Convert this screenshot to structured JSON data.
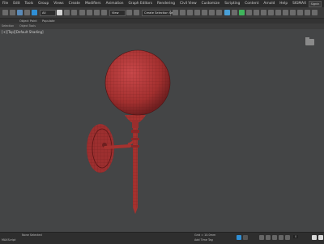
{
  "menubar": {
    "items": [
      "File",
      "Edit",
      "Tools",
      "Group",
      "Views",
      "Create",
      "Modifiers",
      "Animation",
      "Graph Editors",
      "Rendering",
      "Civil View",
      "Customize",
      "Scripting",
      "Content",
      "Arnold",
      "Help",
      "SIGMAX"
    ],
    "search_label": "Signin"
  },
  "toolbar": {
    "filter_value": "All",
    "view_value": "View",
    "selection_set_value": "Create Selection Se"
  },
  "ribbon": {
    "tabs": [
      "Object Paint",
      "Populate"
    ],
    "row_labels": [
      "Selection",
      "Object Tools"
    ]
  },
  "viewport": {
    "label": "[+][Top][Default Shading]"
  },
  "statusbar": {
    "left_text": "MAXScript",
    "selection_text": "None Selected",
    "coord_text": "Grid = 10.0mm",
    "time_tag": "Add Time Tag",
    "frame_value": "0"
  },
  "colors": {
    "model": "#b0383a",
    "model_dark": "#7e2526",
    "viewport_bg": "#444546",
    "accent": "#2f8fd6"
  }
}
